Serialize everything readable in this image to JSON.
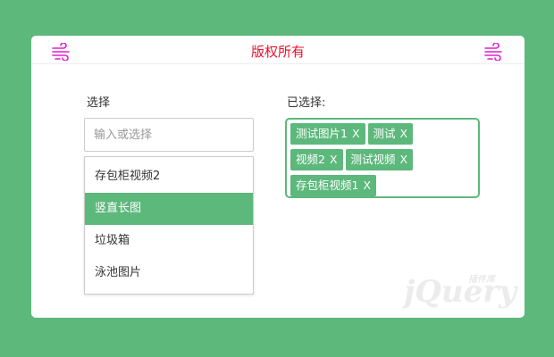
{
  "header": {
    "title": "版权所有",
    "icon_color": "#e11fd4",
    "title_color": "#e8112d"
  },
  "picker": {
    "label": "选择",
    "placeholder": "输入或选择",
    "options": [
      {
        "label": "存包柜视频2",
        "active": false
      },
      {
        "label": "竖直长图",
        "active": true
      },
      {
        "label": "垃圾箱",
        "active": false
      },
      {
        "label": "泳池图片",
        "active": false
      }
    ]
  },
  "selected": {
    "label": "已选择:",
    "tags": [
      {
        "label": "测试图片1",
        "close": "X"
      },
      {
        "label": "测试",
        "close": "X"
      },
      {
        "label": "视频2",
        "close": "X"
      },
      {
        "label": "测试视频",
        "close": "X"
      },
      {
        "label": "存包柜视频1",
        "close": "X"
      }
    ]
  },
  "watermark": {
    "brand": "jQuery",
    "sub": "插件库"
  },
  "colors": {
    "accent": "#5db87c",
    "background": "#5db87c"
  }
}
